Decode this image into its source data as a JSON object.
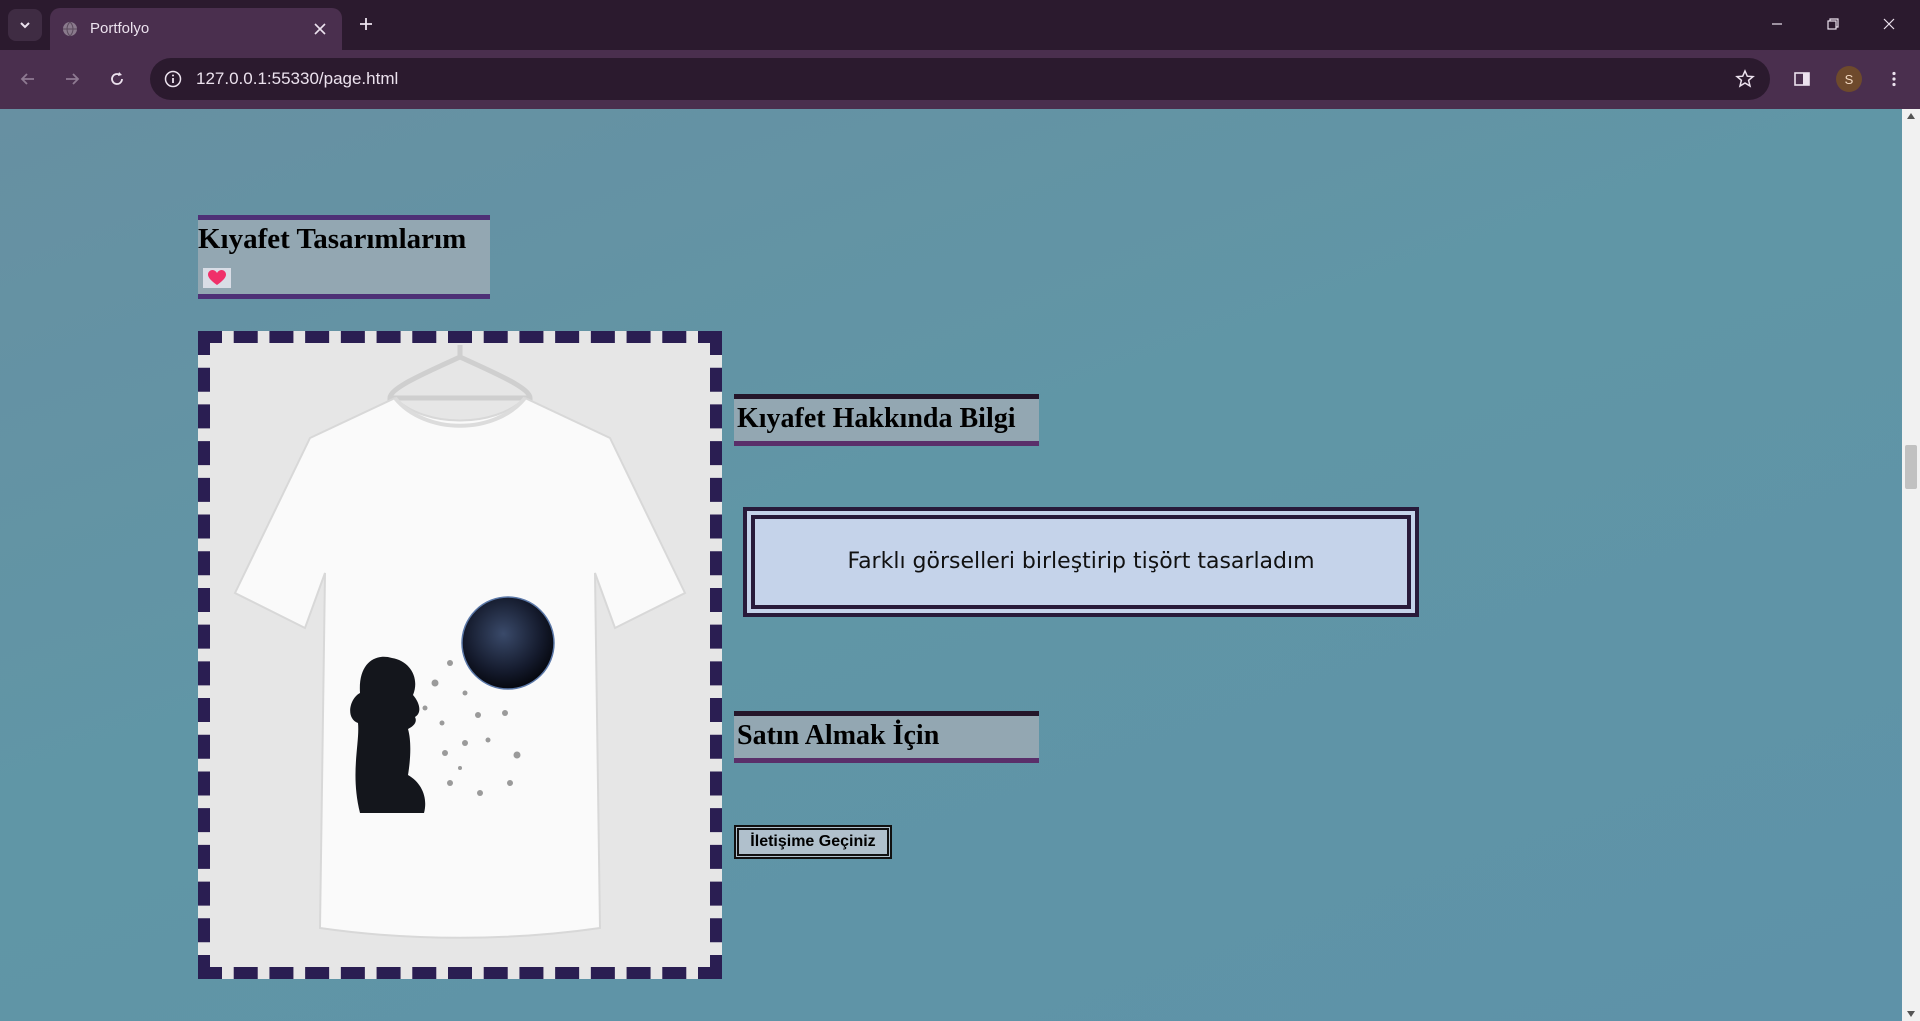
{
  "browser": {
    "tab_title": "Portfolyo",
    "url": "127.0.0.1:55330/page.html",
    "profile_initial": "S"
  },
  "page": {
    "heading": "Kıyafet Tasarımlarım",
    "info_title": "Kıyafet Hakkında Bilgi",
    "info_text": "Farklı görselleri birleştirip tişört tasarladım",
    "buy_title": "Satın Almak İçin",
    "contact_button": "İletişime Geçiniz"
  },
  "colors": {
    "chrome_dark": "#2b1a2e",
    "chrome_tab": "#4a2f4e",
    "page_bg": "#6096a6",
    "heading_border": "#4e3076",
    "frame_dash": "#2a1e52",
    "info_bg": "#c5d3ea"
  }
}
